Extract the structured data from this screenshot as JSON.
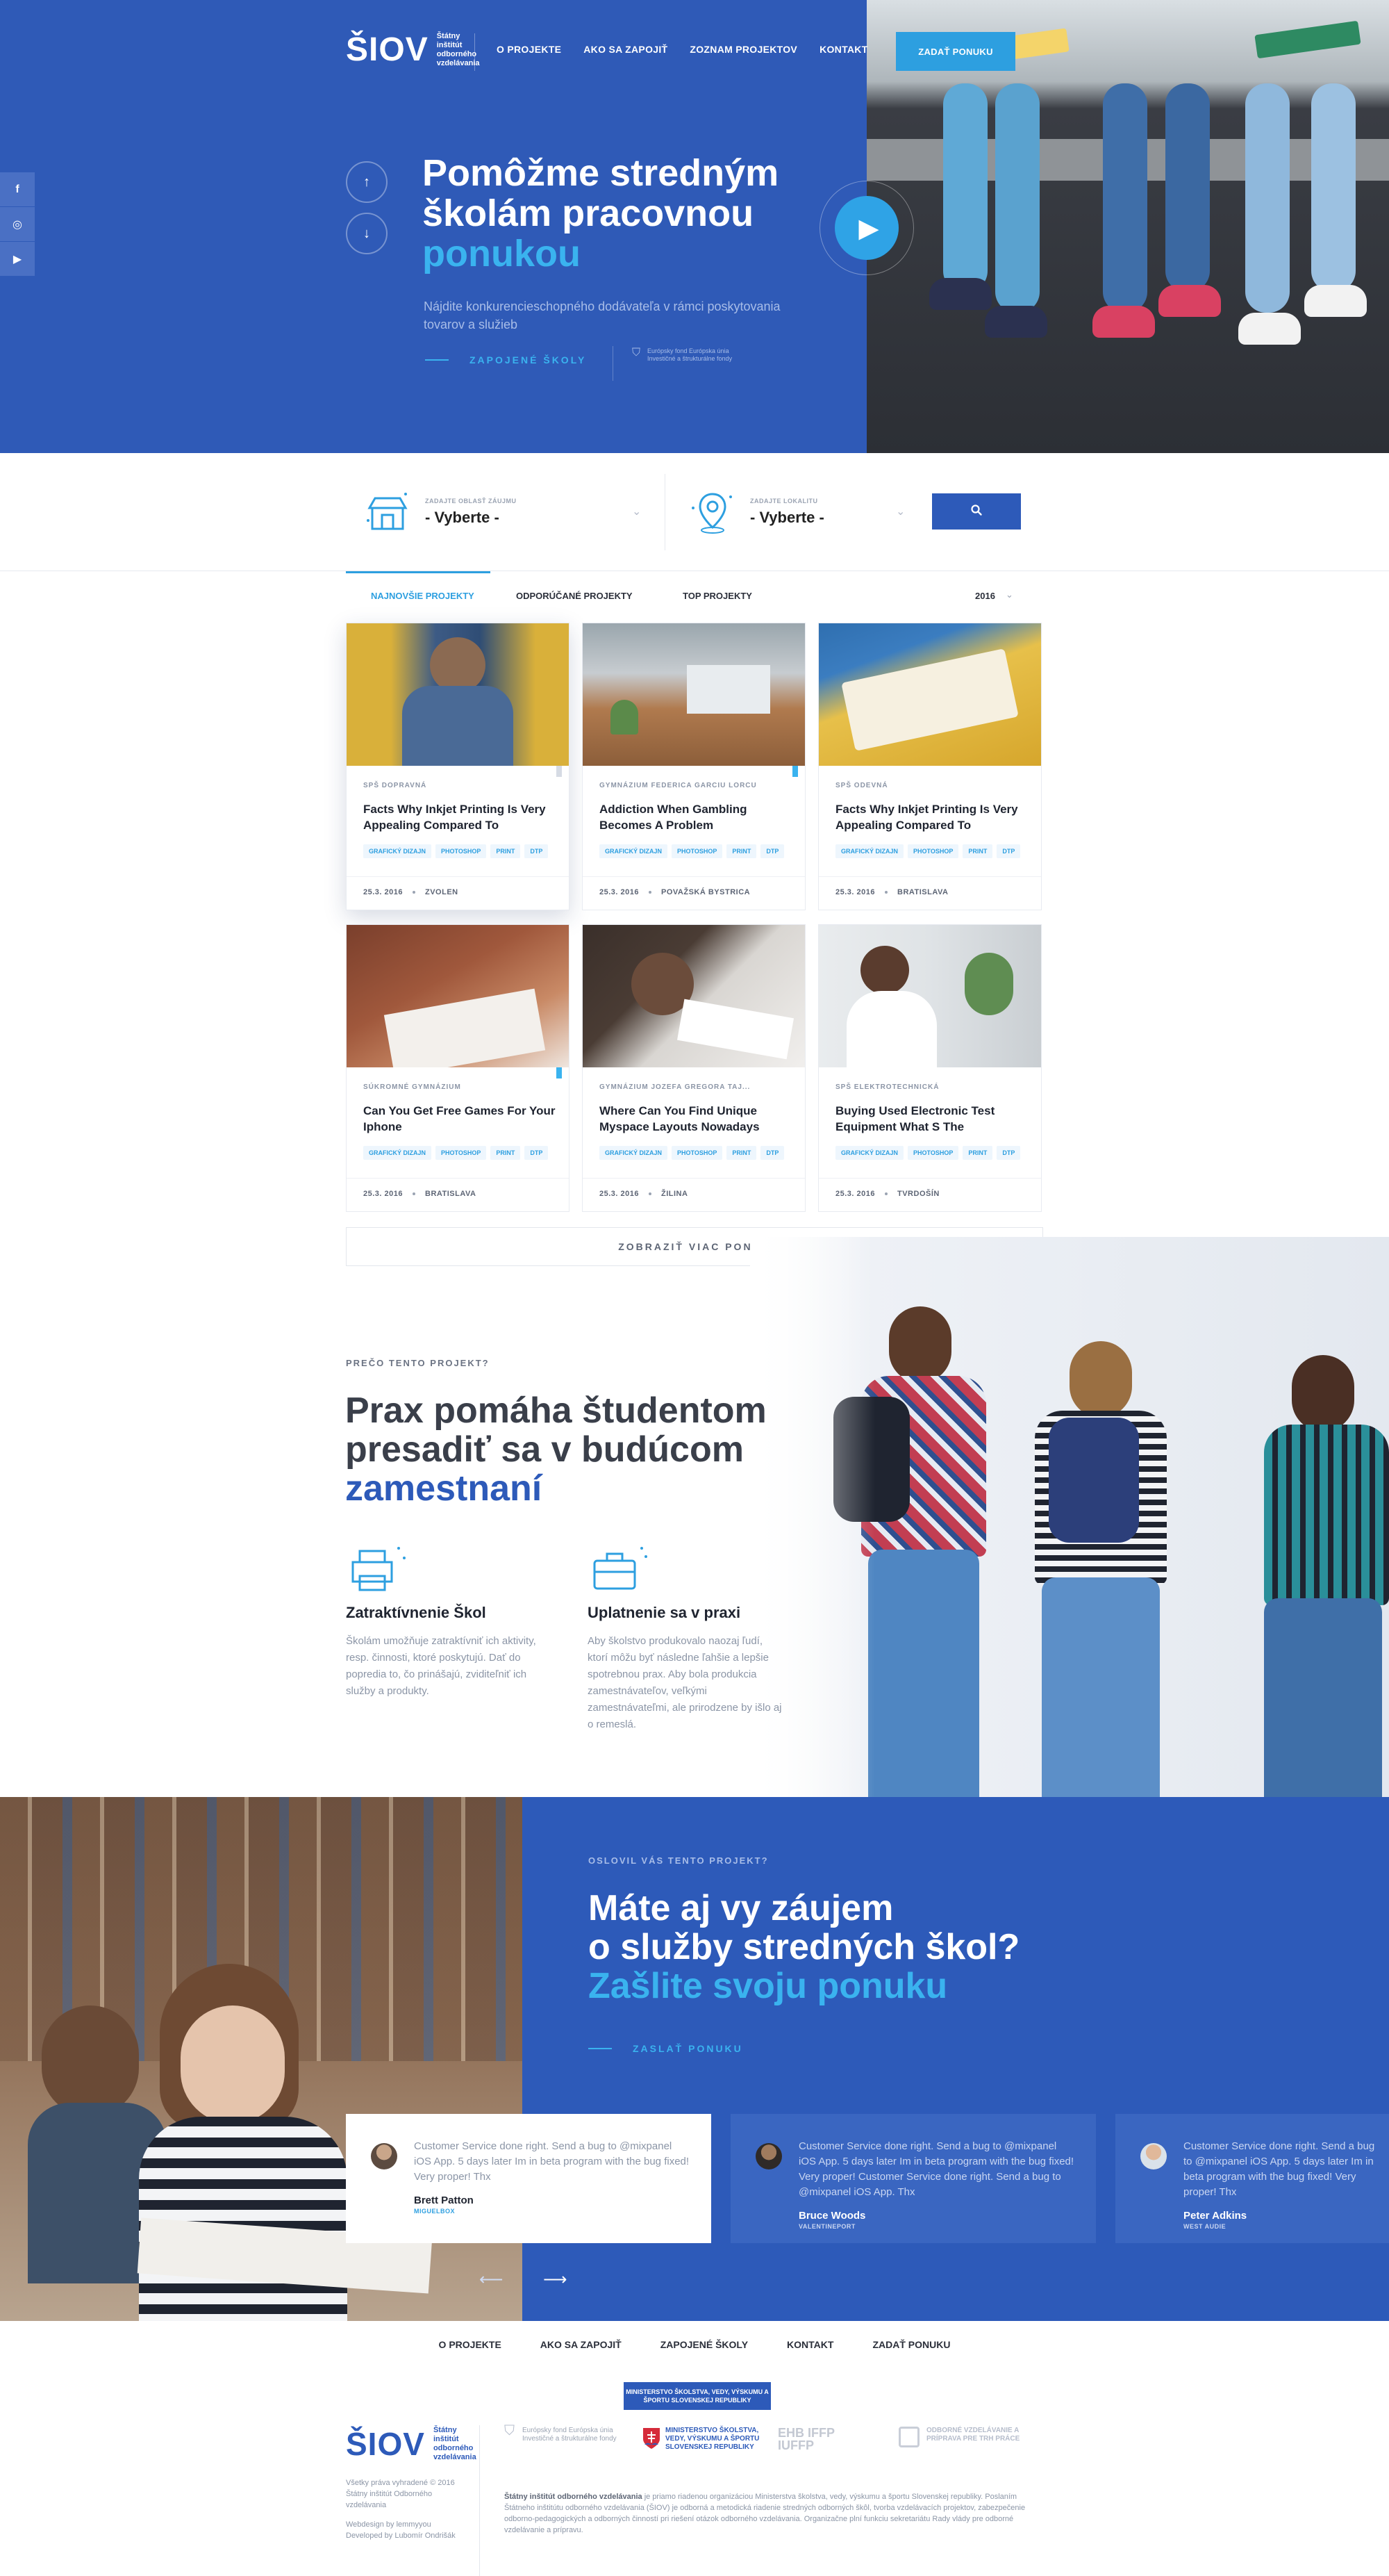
{
  "header": {
    "logo_text": "ŠIOV",
    "logo_sub": "Štátny inštitút odborného vzdelávania",
    "nav": [
      "O PROJEKTE",
      "AKO SA ZAPOJIŤ",
      "ZOZNAM PROJEKTOV",
      "KONTAKT"
    ],
    "cta": "ZADAŤ PONUKU"
  },
  "social": {
    "facebook": "f",
    "instagram": "◎",
    "youtube": "▶"
  },
  "hero": {
    "title_line1": "Pomôžme stredným",
    "title_line2": "školám pracovnou",
    "title_accent": "ponukou",
    "description": "Nájdite konkurencieschopného dodávateľa v rámci poskytovania tovarov a služieb",
    "link": "ZAPOJENÉ ŠKOLY",
    "badge": "Európsky fond Európska únia Investičné a štrukturálne fondy"
  },
  "search": {
    "field1_label": "ZADAJTE OBLASŤ ZÁUJMU",
    "field1_value": "- Vyberte -",
    "field2_label": "ZADAJTE LOKALITU",
    "field2_value": "- Vyberte -",
    "button_icon": "search-icon"
  },
  "tabs": {
    "items": [
      "NAJNOVŠIE PROJEKTY",
      "ODPORÚČANÉ PROJEKTY",
      "TOP PROJEKTY"
    ],
    "active": 0,
    "year": "2016"
  },
  "cards": [
    {
      "school": "SPŠ DOPRAVNÁ",
      "title": "Facts Why Inkjet Printing Is Very Appealing Compared To",
      "date": "25.3. 2016",
      "city": "ZVOLEN"
    },
    {
      "school": "GYMNÁZIUM FEDERICA GARCIU LORCU",
      "title": "Addiction When Gambling Becomes A Problem",
      "date": "25.3. 2016",
      "city": "POVAŽSKÁ BYSTRICA"
    },
    {
      "school": "SPŠ ODEVNÁ",
      "title": "Facts Why Inkjet Printing Is Very Appealing Compared To",
      "date": "25.3. 2016",
      "city": "BRATISLAVA"
    },
    {
      "school": "SÚKROMNÉ GYMNÁZIUM",
      "title": "Can You Get Free Games For Your Iphone",
      "date": "25.3. 2016",
      "city": "BRATISLAVA"
    },
    {
      "school": "GYMNÁZIUM JOZEFA GREGORA TAJ...",
      "title": "Where Can You Find Unique Myspace Layouts Nowadays",
      "date": "25.3. 2016",
      "city": "ŽILINA"
    },
    {
      "school": "SPŠ ELEKTROTECHNICKÁ",
      "title": "Buying Used Electronic Test Equipment What S The",
      "date": "25.3. 2016",
      "city": "TVRDOŠÍN"
    }
  ],
  "card_tags": [
    "GRAFICKÝ DIZAJN",
    "PHOTOSHOP",
    "PRINT",
    "DTP"
  ],
  "more_button": "ZOBRAZIŤ VIAC PONÚK",
  "why": {
    "kicker": "PREČO TENTO PROJEKT?",
    "title_line1": "Prax pomáha študentom",
    "title_line2": "presadiť sa v budúcom",
    "title_accent": "zamestnaní",
    "features": [
      {
        "title": "Zatraktívnenie Škol",
        "text": "Školám umožňuje zatraktívniť ich aktivity, resp. činnosti, ktoré poskytujú. Dať do popredia to, čo prinášajú, zviditeľniť ich služby a produkty."
      },
      {
        "title": "Uplatnenie sa v praxi",
        "text": "Aby školstvo produkovalo naozaj ľudí, ktorí môžu byť následne ľahšie a lepšie spotrebnou prax. Aby bola produkcia zamestnávateľov, veľkými zamestnávateľmi, ale prirodzene by išlo aj o remeslá."
      }
    ]
  },
  "offer": {
    "kicker": "OSLOVIL VÁS TENTO PROJEKT?",
    "title_line1": "Máte aj vy záujem",
    "title_line2": "o služby stredných škol?",
    "title_accent": "Zašlite svoju ponuku",
    "link": "ZASLAŤ PONUKU"
  },
  "testimonials": [
    {
      "quote": "Customer Service done right. Send a bug to @mixpanel iOS App. 5 days later Im in beta program with the bug fixed! Very proper! Thx",
      "name": "Brett Patton",
      "company": "MIGUELBOX"
    },
    {
      "quote": "Customer Service done right. Send a bug to @mixpanel iOS App. 5 days later Im in beta program with the bug fixed! Very proper! Customer Service done right. Send a bug to @mixpanel iOS App. Thx",
      "name": "Bruce Woods",
      "company": "VALENTINEPORT"
    },
    {
      "quote": "Customer Service done right. Send a bug to @mixpanel iOS App. 5 days later Im in beta program with the bug fixed! Very proper! Thx",
      "name": "Peter Adkins",
      "company": "WEST AUDIE"
    }
  ],
  "footer": {
    "nav": [
      "O PROJEKTE",
      "AKO SA ZAPOJIŤ",
      "ZAPOJENÉ ŠKOLY",
      "KONTAKT",
      "ZADAŤ PONUKU"
    ],
    "ministry_banner": "MINISTERSTVO ŠKOLSTVA, VEDY, VÝSKUMU A ŠPORTU SLOVENSKEJ REPUBLIKY",
    "copyright": "Všetky práva vyhradené © 2016 Štátny inštitút Odborného vzdelávania",
    "webdesign": "Webdesign by lemmyyou",
    "developed": "Developed by Lubomír Ondrišák",
    "partner1": "Európsky fond Európska únia Investičné a štrukturálne fondy",
    "partner2": "MINISTERSTVO ŠKOLSTVA, VEDY, VÝSKUMU A ŠPORTU SLOVENSKEJ REPUBLIKY",
    "partner3": "EHB IFFP IUFFP",
    "partner4": "ODBORNÉ VZDELÁVANIE A PRÍPRAVA PRE TRH PRÁCE",
    "about_bold": "Štátny inštitút odborného vzdelávania",
    "about_text": " je priamo riadenou organizáciou Ministerstva školstva, vedy, výskumu a športu Slovenskej republiky. Poslaním Štátneho inštitútu odborného vzdelávania (ŠIOV) je odborná a metodická riadenie stredných odborných škôl, tvorba vzdelávacích projektov, zabezpečenie odborno-pedagogických a odborných činností pri riešení otázok odborného vzdelávania. Organizačne plní funkciu sekretariátu Rady vlády pre odborné vzdelávanie a prípravu."
  },
  "colors": {
    "primary": "#2f5ab7",
    "accent": "#3ab3ef",
    "button": "#2d9fe0"
  }
}
